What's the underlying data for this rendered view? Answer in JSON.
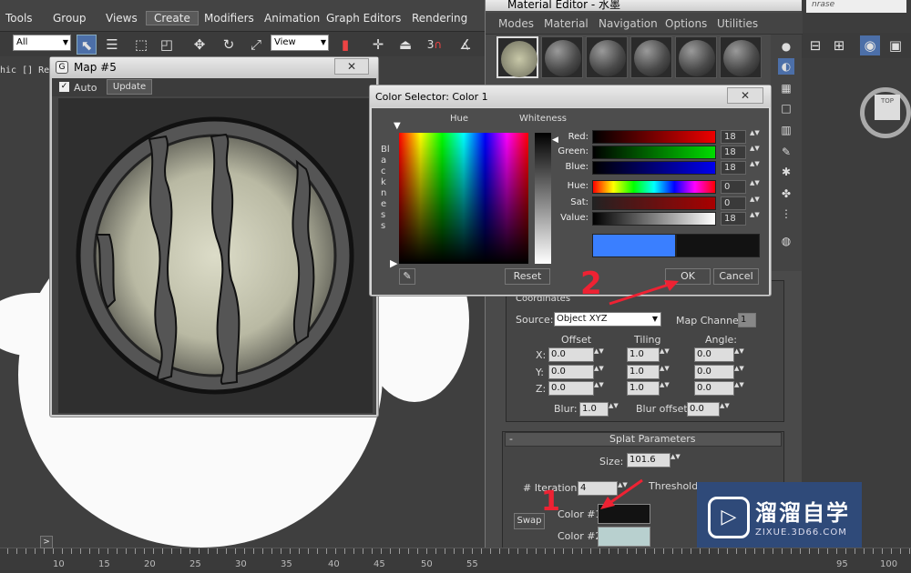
{
  "menubar": {
    "items": [
      "Tools",
      "Group",
      "Views",
      "Create",
      "Modifiers",
      "Animation",
      "Graph Editors",
      "Rendering"
    ],
    "active": "Create"
  },
  "toolbar": {
    "selection_filter": "All",
    "ref_coord": "View",
    "snap_label": "3"
  },
  "viewport": {
    "label": "hic [] Real",
    "viewcube_label": "TOP"
  },
  "map_window": {
    "title": "Map #5",
    "auto_label": "Auto",
    "update_label": "Update",
    "close": "✕"
  },
  "material_editor": {
    "title": "Material Editor - 水墨",
    "menu": [
      "Modes",
      "Material",
      "Navigation",
      "Options",
      "Utilities"
    ],
    "search_text": "nrase"
  },
  "color_selector": {
    "title": "Color Selector: Color 1",
    "hue_label": "Hue",
    "whiteness_label": "Whiteness",
    "blackness_label": "Blackness",
    "rows": [
      {
        "label": "Red:",
        "value": "18"
      },
      {
        "label": "Green:",
        "value": "18"
      },
      {
        "label": "Blue:",
        "value": "18"
      },
      {
        "label": "Hue:",
        "value": "0"
      },
      {
        "label": "Sat:",
        "value": "0"
      },
      {
        "label": "Value:",
        "value": "18"
      }
    ],
    "reset": "Reset",
    "ok": "OK",
    "cancel": "Cancel",
    "old_color": "#3a7fff",
    "new_color": "#121212",
    "close": "✕"
  },
  "coordinates": {
    "header": "Coordinates",
    "source_label": "Source:",
    "source_value": "Object XYZ",
    "map_channel_label": "Map Channel:",
    "map_channel_value": "1",
    "offset_label": "Offset",
    "tiling_label": "Tiling",
    "angle_label": "Angle:",
    "axes": [
      "X:",
      "Y:",
      "Z:"
    ],
    "offset": [
      "0.0",
      "0.0",
      "0.0"
    ],
    "tiling": [
      "1.0",
      "1.0",
      "1.0"
    ],
    "angle": [
      "0.0",
      "0.0",
      "0.0"
    ],
    "blur_label": "Blur:",
    "blur_value": "1.0",
    "blur_offset_label": "Blur offset:",
    "blur_offset_value": "0.0"
  },
  "splat": {
    "header": "Splat Parameters",
    "collapse": "-",
    "size_label": "Size:",
    "size_value": "101.6",
    "iterations_label": "# Iterations:",
    "iterations_value": "4",
    "threshold_label": "Threshold:",
    "swap": "Swap",
    "color1_label": "Color #1",
    "color2_label": "Color #2",
    "color1": "#121212",
    "color2": "#b8d0cf"
  },
  "annotations": {
    "one": "1",
    "two": "2"
  },
  "watermark": {
    "name": "溜溜自学",
    "url": "ZIXUE.3D66.COM"
  },
  "timeline": {
    "play": ">",
    "ticks": [
      "10",
      "15",
      "20",
      "25",
      "30",
      "35",
      "40",
      "45",
      "50",
      "55"
    ],
    "ticks_right": [
      "95",
      "100"
    ]
  }
}
